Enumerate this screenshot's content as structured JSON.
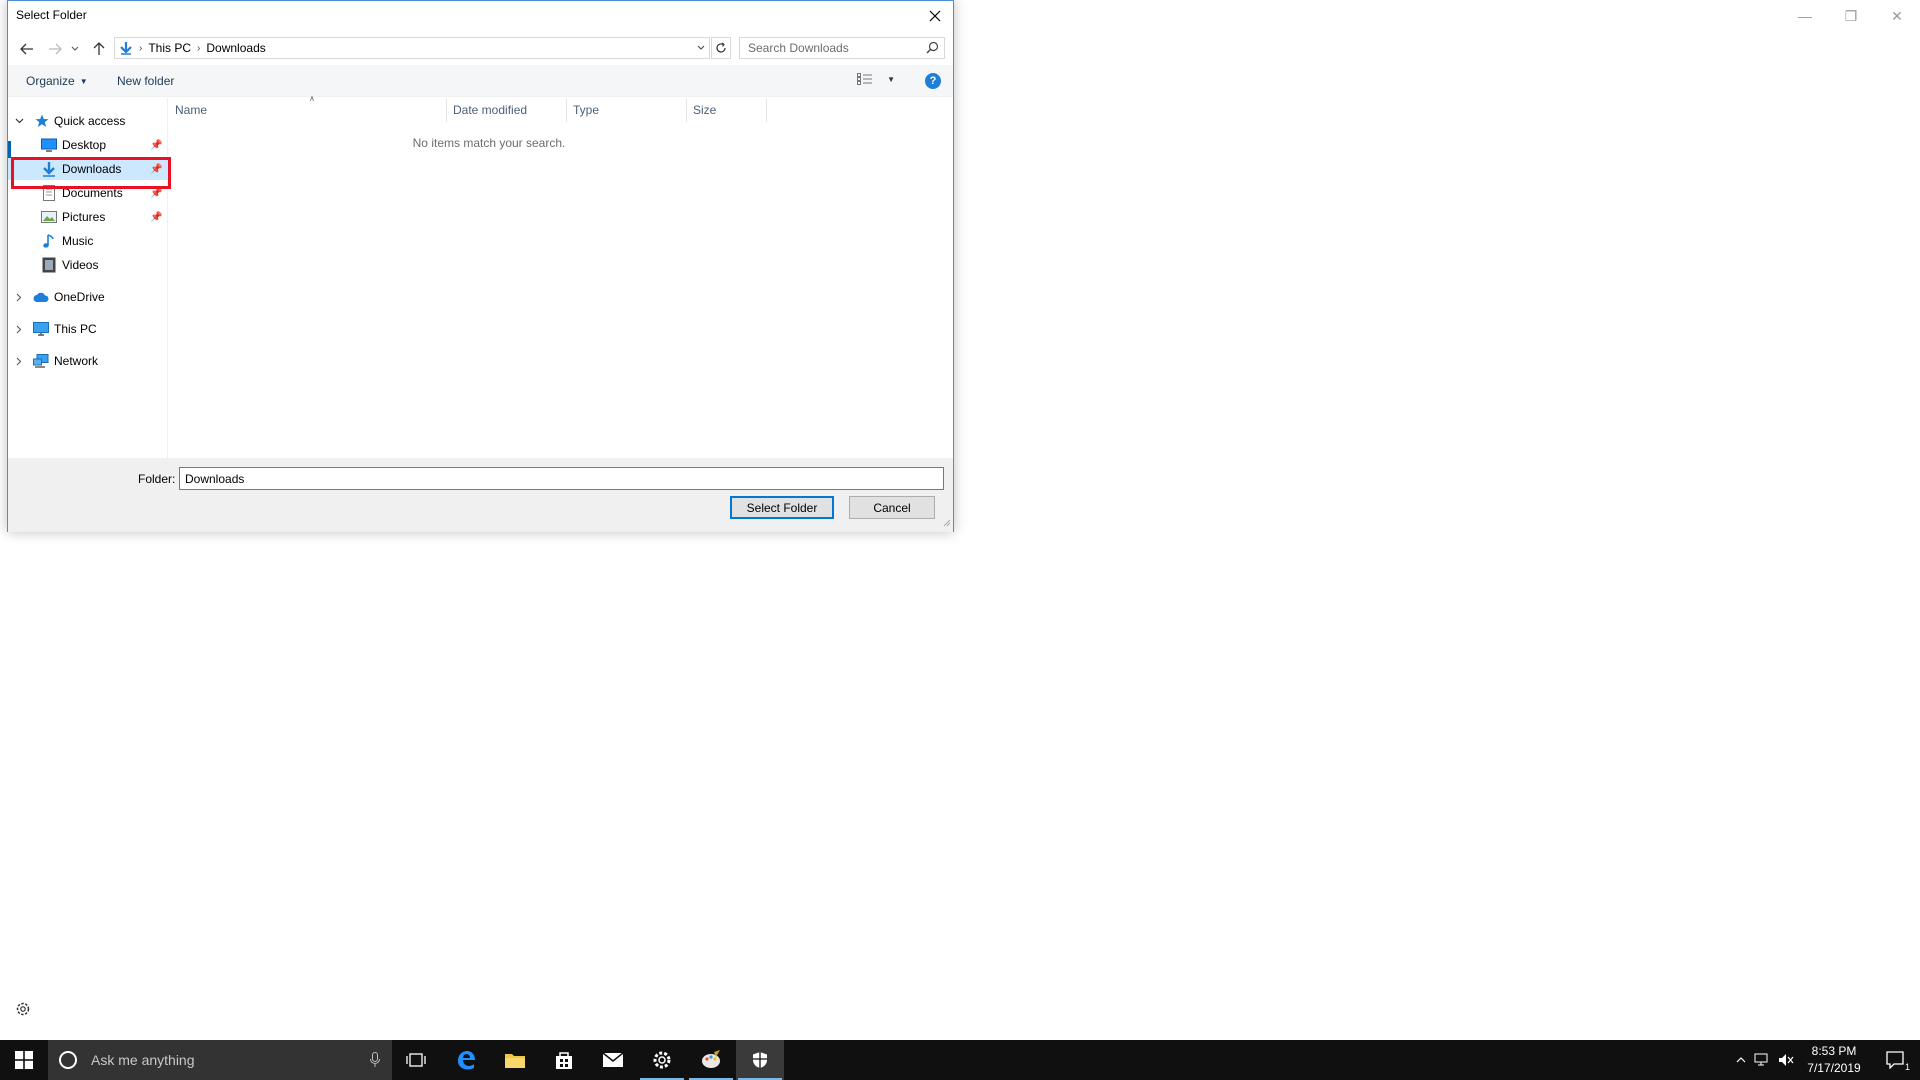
{
  "dialog": {
    "title": "Select Folder"
  },
  "address": {
    "crumbs": [
      "This PC",
      "Downloads"
    ],
    "search_placeholder": "Search Downloads"
  },
  "toolbar": {
    "organize": "Organize",
    "new_folder": "New folder",
    "help": "?"
  },
  "nav": {
    "quick_access": "Quick access",
    "items": [
      {
        "label": "Desktop",
        "icon": "desktop-icon"
      },
      {
        "label": "Downloads",
        "icon": "download-arrow-icon",
        "selected": true
      },
      {
        "label": "Documents",
        "icon": "documents-icon"
      },
      {
        "label": "Pictures",
        "icon": "pictures-icon"
      },
      {
        "label": "Music",
        "icon": "music-note-icon"
      },
      {
        "label": "Videos",
        "icon": "film-icon"
      }
    ],
    "roots": [
      {
        "label": "OneDrive",
        "icon": "cloud-icon"
      },
      {
        "label": "This PC",
        "icon": "computer-icon"
      },
      {
        "label": "Network",
        "icon": "network-icon"
      }
    ]
  },
  "columns": [
    "Name",
    "Date modified",
    "Type",
    "Size"
  ],
  "empty_message": "No items match your search.",
  "bottom": {
    "folder_label": "Folder:",
    "folder_value": "Downloads",
    "select_button": "Select Folder",
    "cancel_button": "Cancel"
  },
  "taskbar": {
    "search_placeholder": "Ask me anything",
    "time": "8:53 PM",
    "date": "7/17/2019",
    "notification_count": "1"
  },
  "colors": {
    "accent": "#0078d7",
    "selection": "#cce8ff",
    "highlight_box": "#e81123",
    "taskbar": "#101010"
  }
}
